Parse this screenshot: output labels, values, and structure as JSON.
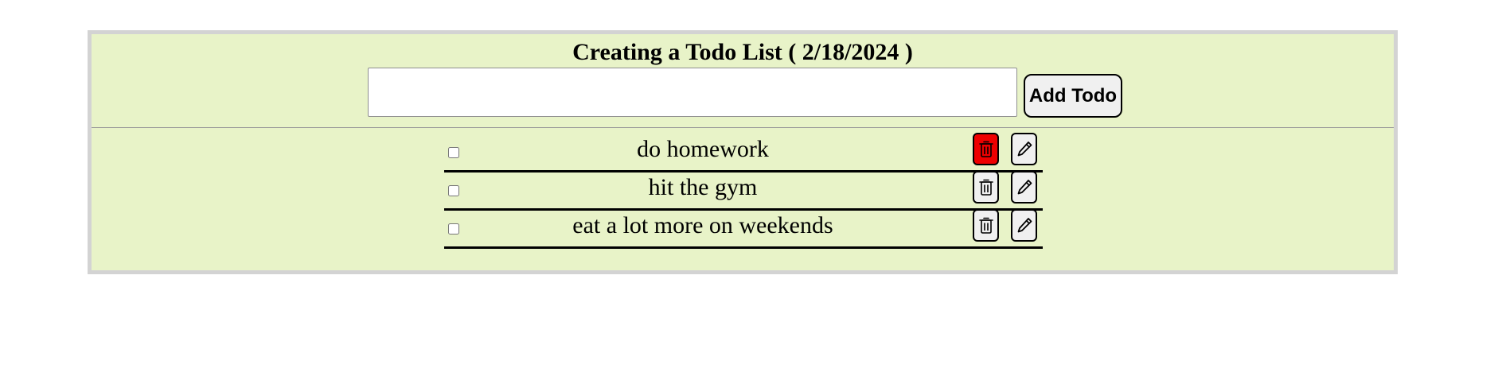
{
  "header": {
    "title": "Creating a Todo List ( 2/18/2024 )",
    "input_value": "",
    "add_button_label": "Add Todo"
  },
  "todos": [
    {
      "text": "do homework",
      "completed": false,
      "delete_icon": "trash-icon",
      "edit_icon": "pencil-icon",
      "delete_highlighted": true
    },
    {
      "text": "hit the gym",
      "completed": false,
      "delete_icon": "trash-icon",
      "edit_icon": "pencil-icon",
      "delete_highlighted": false
    },
    {
      "text": "eat a lot more on weekends",
      "completed": false,
      "delete_icon": "trash-icon",
      "edit_icon": "pencil-icon",
      "delete_highlighted": false
    }
  ],
  "colors": {
    "panel_background": "#e8f3c8",
    "panel_border": "#d3d3d3",
    "delete_highlight": "#ee0000",
    "button_background": "#f0f0f0"
  }
}
